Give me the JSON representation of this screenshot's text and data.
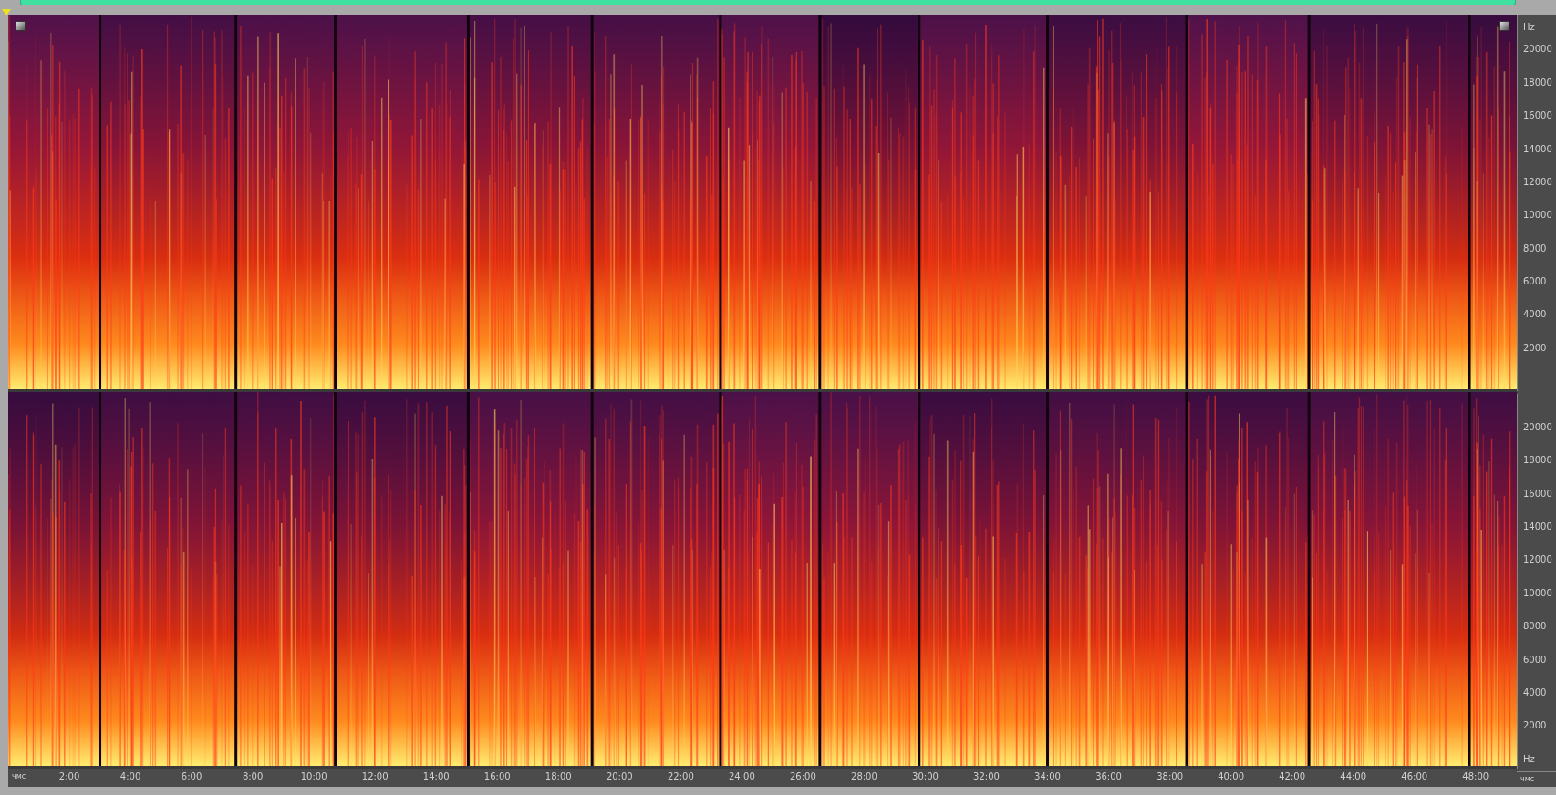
{
  "channels": [
    {
      "labels": [
        {
          "kind": "unit",
          "text": "Hz"
        },
        {
          "kind": "tick",
          "text": "20000"
        },
        {
          "kind": "tick",
          "text": "18000"
        },
        {
          "kind": "tick",
          "text": "16000"
        },
        {
          "kind": "tick",
          "text": "14000"
        },
        {
          "kind": "tick",
          "text": "12000"
        },
        {
          "kind": "tick",
          "text": "10000"
        },
        {
          "kind": "tick",
          "text": "8000"
        },
        {
          "kind": "tick",
          "text": "6000"
        },
        {
          "kind": "tick",
          "text": "4000"
        },
        {
          "kind": "tick",
          "text": "2000"
        }
      ]
    },
    {
      "labels": [
        {
          "kind": "tick",
          "text": "20000"
        },
        {
          "kind": "tick",
          "text": "18000"
        },
        {
          "kind": "tick",
          "text": "16000"
        },
        {
          "kind": "tick",
          "text": "14000"
        },
        {
          "kind": "tick",
          "text": "12000"
        },
        {
          "kind": "tick",
          "text": "10000"
        },
        {
          "kind": "tick",
          "text": "8000"
        },
        {
          "kind": "tick",
          "text": "6000"
        },
        {
          "kind": "tick",
          "text": "4000"
        },
        {
          "kind": "tick",
          "text": "2000"
        },
        {
          "kind": "unit",
          "text": "Hz"
        }
      ]
    }
  ],
  "time_ruler": {
    "unit_label": "чмс",
    "end_label": "чмс",
    "ticks": [
      "2:00",
      "4:00",
      "6:00",
      "8:00",
      "10:00",
      "12:00",
      "14:00",
      "16:00",
      "18:00",
      "20:00",
      "22:00",
      "24:00",
      "26:00",
      "28:00",
      "30:00",
      "32:00",
      "34:00",
      "36:00",
      "38:00",
      "40:00",
      "42:00",
      "44:00",
      "46:00",
      "48:00"
    ]
  }
}
